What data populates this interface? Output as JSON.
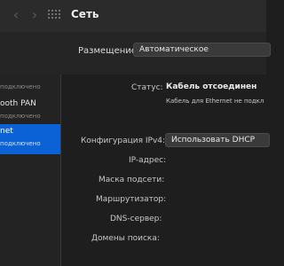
{
  "window": {
    "title": "Сеть"
  },
  "toolbar": {
    "back_icon": "chevron-left-icon",
    "forward_icon": "chevron-right-icon",
    "grid_icon": "grid-icon"
  },
  "placement": {
    "label": "Размещение:",
    "value": "Автоматическое"
  },
  "sidebar": {
    "items": [
      {
        "name": "",
        "status": "подключено"
      },
      {
        "name": "ooth PAN",
        "status": "подключено"
      },
      {
        "name": "net",
        "status": "подключено"
      }
    ]
  },
  "details": {
    "status_label": "Статус:",
    "status_value": "Кабель отсоединен",
    "status_desc": "Кабель для Ethernet не подкл",
    "config_label": "Конфигурация IPv4:",
    "config_value": "Использовать DHCP",
    "fields": {
      "ip": "IP-адрес:",
      "mask": "Маска подсети:",
      "router": "Маршрутизатор:",
      "dns": "DNS-сервер:",
      "domains": "Домены поиска:"
    }
  },
  "colors": {
    "accent": "#0a62d6",
    "background": "#1e1e1e"
  }
}
